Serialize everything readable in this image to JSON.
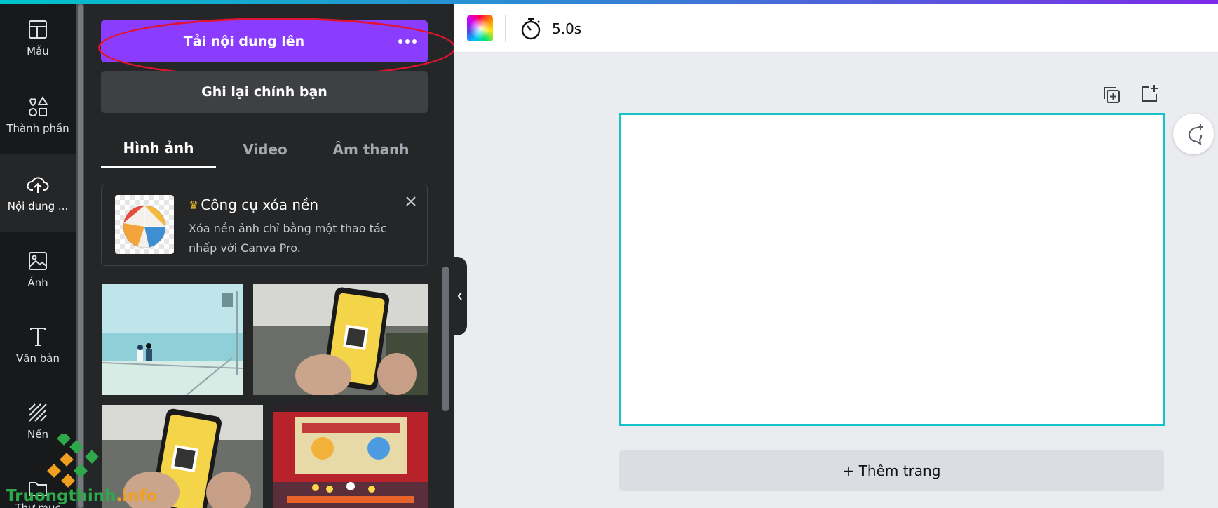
{
  "sidebar": {
    "items": [
      {
        "label": "Mẫu",
        "icon": "template-icon"
      },
      {
        "label": "Thành phần",
        "icon": "elements-icon"
      },
      {
        "label": "Nội dung ...",
        "icon": "upload-cloud-icon",
        "active": true
      },
      {
        "label": "Ảnh",
        "icon": "photo-icon"
      },
      {
        "label": "Văn bản",
        "icon": "text-icon"
      },
      {
        "label": "Nền",
        "icon": "background-icon"
      },
      {
        "label": "Thư mục",
        "icon": "folder-icon"
      }
    ]
  },
  "panel": {
    "upload_button": "Tải nội dung lên",
    "record_button": "Ghi lại chính bạn",
    "tabs": [
      {
        "label": "Hình ảnh",
        "active": true
      },
      {
        "label": "Video",
        "active": false
      },
      {
        "label": "Âm thanh",
        "active": false
      }
    ],
    "promo": {
      "title": "Công cụ xóa nền",
      "description": "Xóa nền ảnh chỉ bằng một thao tác nhấp với Canva Pro."
    },
    "images": [
      {
        "name": "beach-couple-image"
      },
      {
        "name": "phone-qr-image-1"
      },
      {
        "name": "phone-qr-image-2"
      },
      {
        "name": "stage-performance-image"
      }
    ]
  },
  "toolbar": {
    "duration": "5.0s"
  },
  "canvas": {
    "add_page": "+ Thêm trang"
  },
  "watermark": {
    "brand": "Truongthinh",
    "suffix": ".info"
  },
  "colors": {
    "accent_purple": "#8b3dff",
    "canvas_border": "#13c3c9",
    "highlight_oval": "#e0142f"
  }
}
